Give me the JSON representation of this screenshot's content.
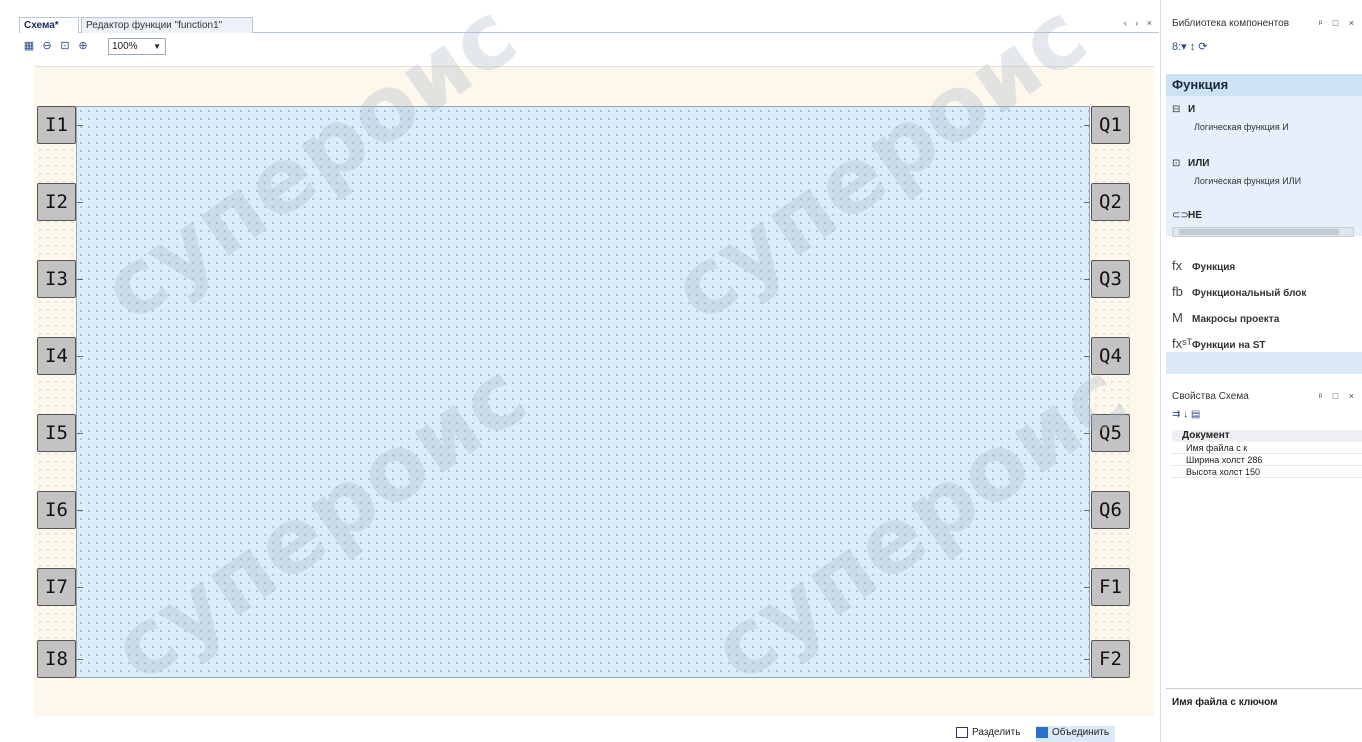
{
  "tabs": [
    {
      "label": "Схема*",
      "active": true
    },
    {
      "label": "Редактор функции \"function1\"",
      "active": false
    }
  ],
  "tab_controls": "‹ › ×",
  "toolbar": {
    "grid_icon": "grid-icon",
    "zoom_out_icon": "zoom-out-icon",
    "zoom_fit_icon": "zoom-fit-icon",
    "zoom_in_icon": "zoom-in-icon",
    "zoom_value": "100%"
  },
  "inputs": [
    "I1",
    "I2",
    "I3",
    "I4",
    "I5",
    "I6",
    "I7",
    "I8"
  ],
  "outputs": [
    "Q1",
    "Q2",
    "Q3",
    "Q4",
    "Q5",
    "Q6",
    "F1",
    "F2"
  ],
  "bottom_bar": {
    "split_label": "Разделить",
    "merge_label": "Объединить"
  },
  "library": {
    "title": "Библиотека компонентов",
    "controls": "ᵖ □ ×",
    "toolbar": "8:▾ ↕ ⟳",
    "group_header": "Функция",
    "items": [
      {
        "icon": "⊟",
        "name": "И",
        "desc": "Логическая функция И"
      },
      {
        "icon": "⊡",
        "name": "ИЛИ",
        "desc": "Логическая функция ИЛИ"
      },
      {
        "icon": "⊂⊃",
        "name": "НЕ",
        "desc": ""
      }
    ],
    "categories": [
      {
        "icon": "fx",
        "label": "Функция"
      },
      {
        "icon": "fb",
        "label": "Функциональный блок"
      },
      {
        "icon": "M",
        "label": "Макросы проекта"
      },
      {
        "icon": "fxˢᵀ",
        "label": "Функции на ST"
      }
    ]
  },
  "properties": {
    "title": "Свойства Схема",
    "controls": "ᵖ □ ×",
    "toolbar": "⇉ ↓ ▤",
    "group": "Документ",
    "rows": [
      {
        "label": "Имя файла с к",
        "value": ""
      },
      {
        "label": "Ширина холст",
        "value": "286"
      },
      {
        "label": "Высота холст",
        "value": "150"
      }
    ],
    "description": "Имя файла с ключом"
  },
  "watermark": "супероис",
  "colors": {
    "canvas": "#dcecf9",
    "canvas_bg": "#fdf7ec",
    "pin": "#c3c3c3",
    "accent": "#2c6fc9"
  }
}
